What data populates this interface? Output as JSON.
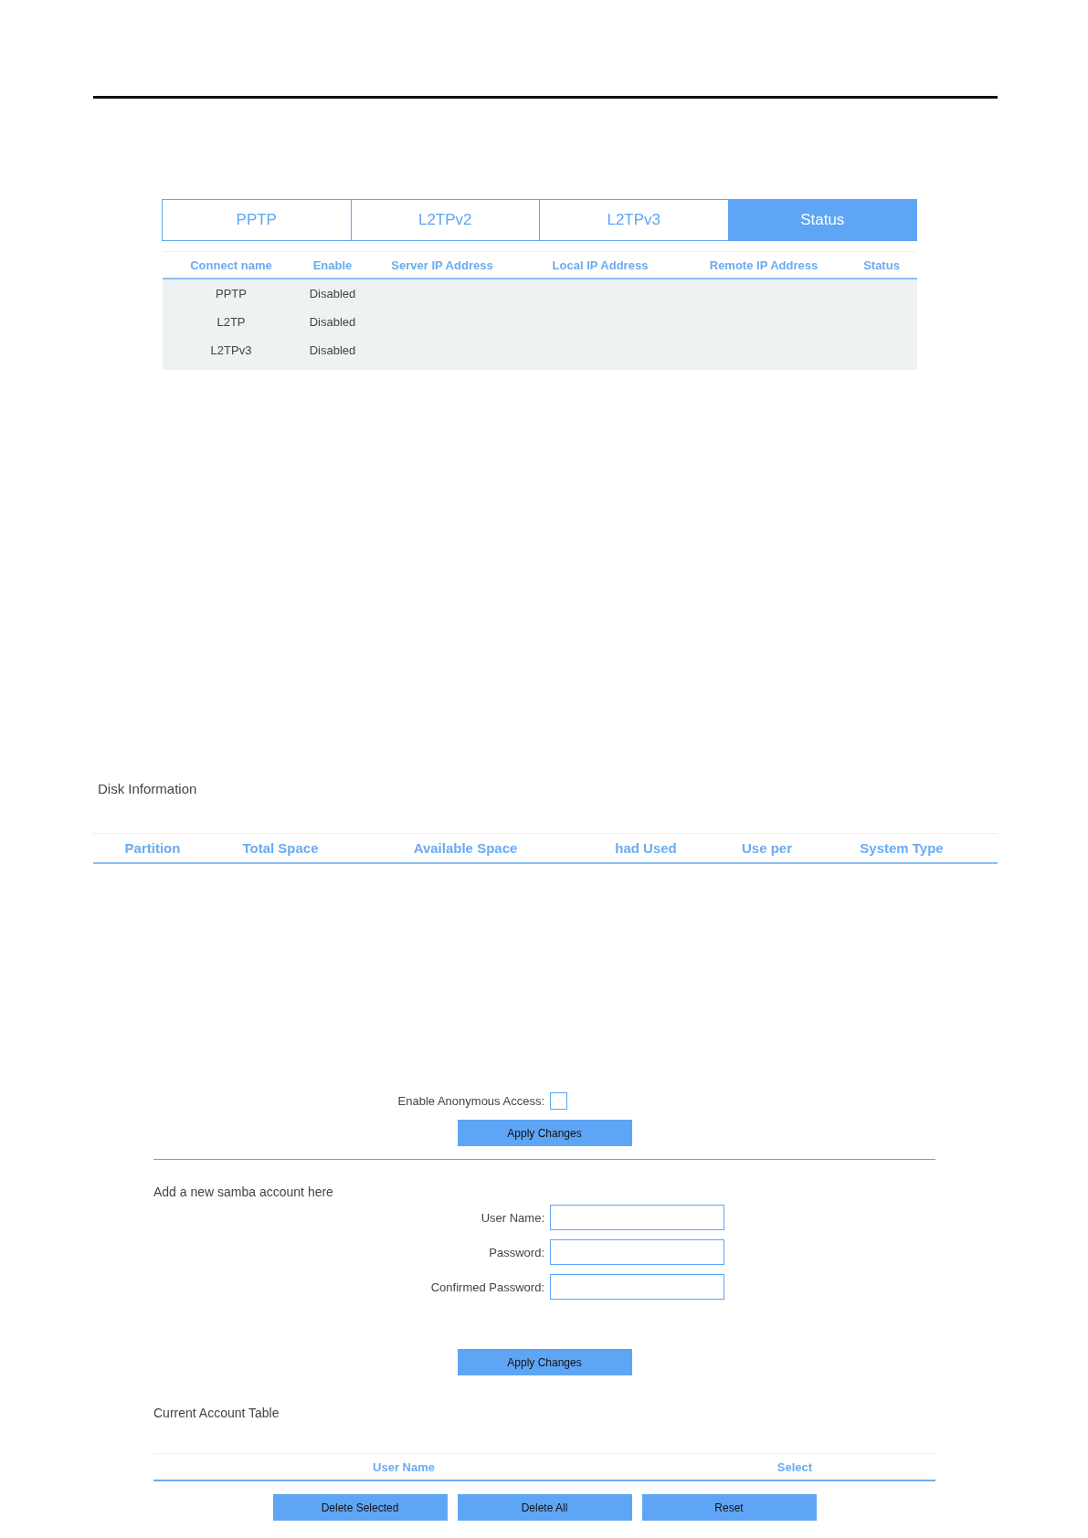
{
  "vpn": {
    "tabs": [
      {
        "label": "PPTP",
        "selected": false
      },
      {
        "label": "L2TPv2",
        "selected": false
      },
      {
        "label": "L2TPv3",
        "selected": false
      },
      {
        "label": "Status",
        "selected": true
      }
    ],
    "columns": [
      "Connect name",
      "Enable",
      "Server IP Address",
      "Local IP Address",
      "Remote IP Address",
      "Status"
    ],
    "rows": [
      [
        "PPTP",
        "Disabled"
      ],
      [
        "L2TP",
        "Disabled"
      ],
      [
        "L2TPv3",
        "Disabled"
      ]
    ]
  },
  "disk": {
    "title": "Disk Information",
    "columns": [
      "Partition",
      "Total Space",
      "Available Space",
      "had Used",
      "Use per",
      "System Type"
    ]
  },
  "samba": {
    "anonymous": {
      "label": "Enable Anonymous Access:",
      "checked": false
    },
    "apply_button": "Apply Changes",
    "add_title": "Add a new samba account here",
    "fields": [
      {
        "label": "User Name:"
      },
      {
        "label": "Password:"
      },
      {
        "label": "Confirmed Password:"
      }
    ],
    "apply_button_2": "Apply Changes",
    "table_title": "Current Account Table",
    "columns": [
      "User Name",
      "Select"
    ],
    "buttons": [
      "Delete Selected",
      "Delete All",
      "Reset"
    ]
  }
}
